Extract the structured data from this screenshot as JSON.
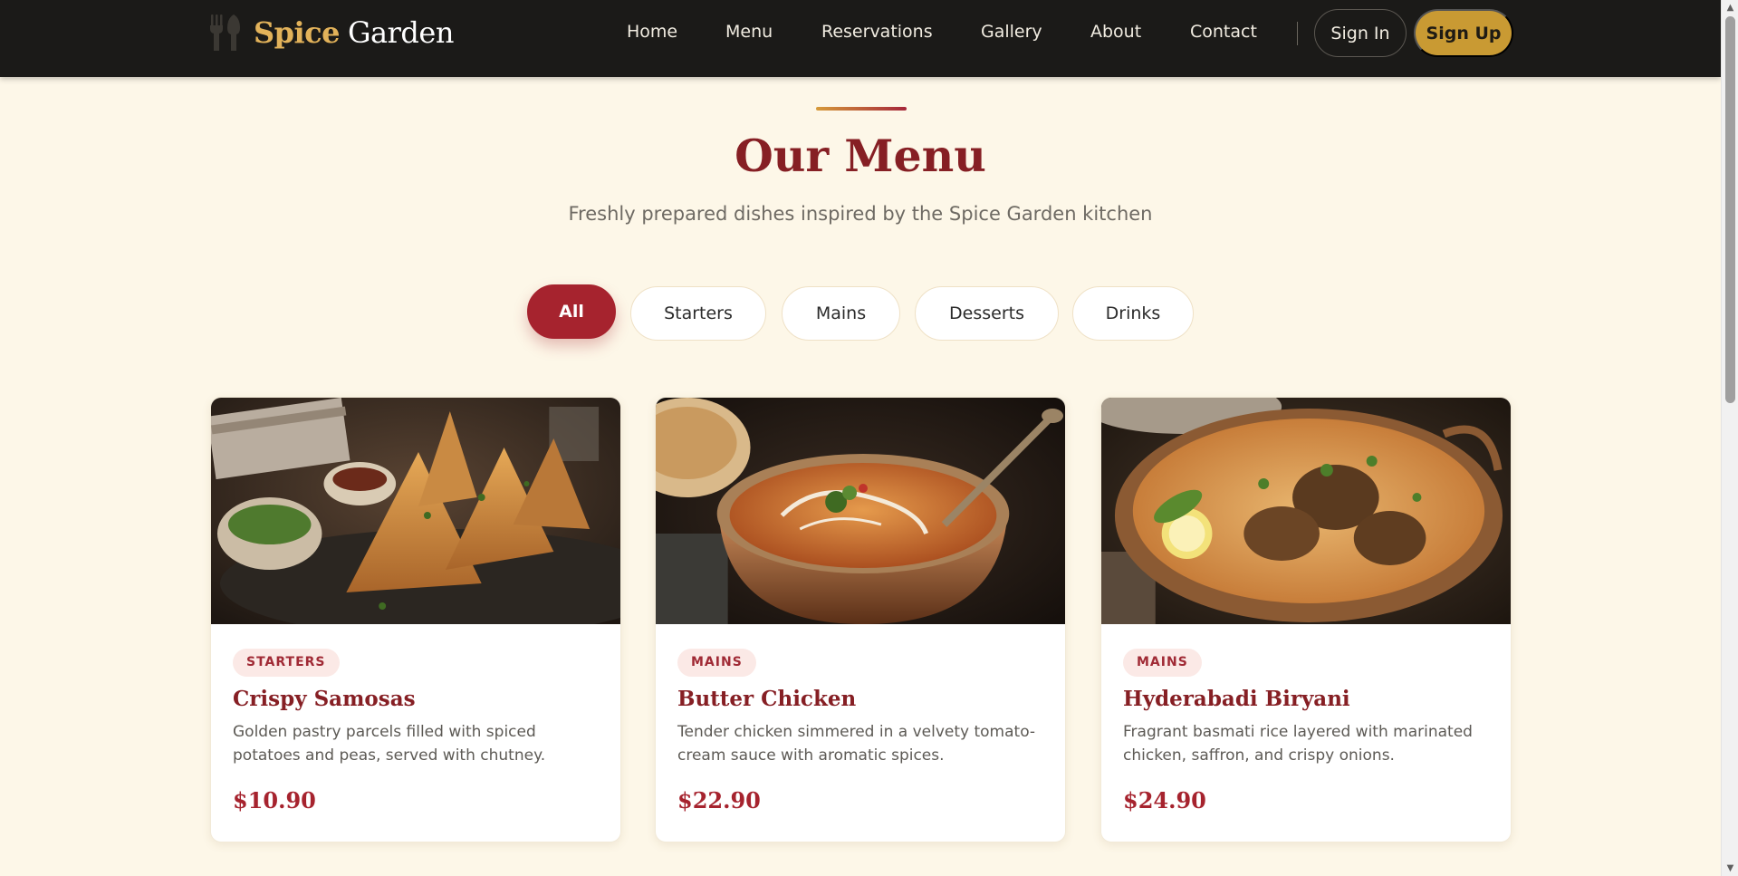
{
  "brand": {
    "name_first": "Spice",
    "name_second": "Garden",
    "icon": "fork-spoon-icon"
  },
  "nav": {
    "links": [
      "Home",
      "Menu",
      "Reservations",
      "Gallery",
      "About",
      "Contact"
    ],
    "sign_in": "Sign In",
    "sign_up": "Sign Up"
  },
  "hero": {
    "title": "Our Menu",
    "subtitle": "Freshly prepared dishes inspired by the Spice Garden kitchen"
  },
  "filters": {
    "items": [
      "All",
      "Starters",
      "Mains",
      "Desserts",
      "Drinks"
    ],
    "active": "All"
  },
  "cards": [
    {
      "category": "STARTERS",
      "name": "Crispy Samosas",
      "description": "Golden pastry parcels filled with spiced potatoes and peas, served with chutney.",
      "price": "$10.90",
      "image": "samosas-photo"
    },
    {
      "category": "MAINS",
      "name": "Butter Chicken",
      "description": "Tender chicken simmered in a velvety tomato-cream sauce with aromatic spices.",
      "price": "$22.90",
      "image": "butter-chicken-photo"
    },
    {
      "category": "MAINS",
      "name": "Hyderabadi Biryani",
      "description": "Fragrant basmati rice layered with marinated chicken, saffron, and crispy onions.",
      "price": "$24.90",
      "image": "biryani-photo"
    }
  ],
  "colors": {
    "header_bg": "#1b1a18",
    "brand_gold": "#e2b25a",
    "accent_red": "#a6232e",
    "title_maroon": "#861f24",
    "signup_gold": "#c99a33",
    "page_bg": "#fdf7e8"
  }
}
